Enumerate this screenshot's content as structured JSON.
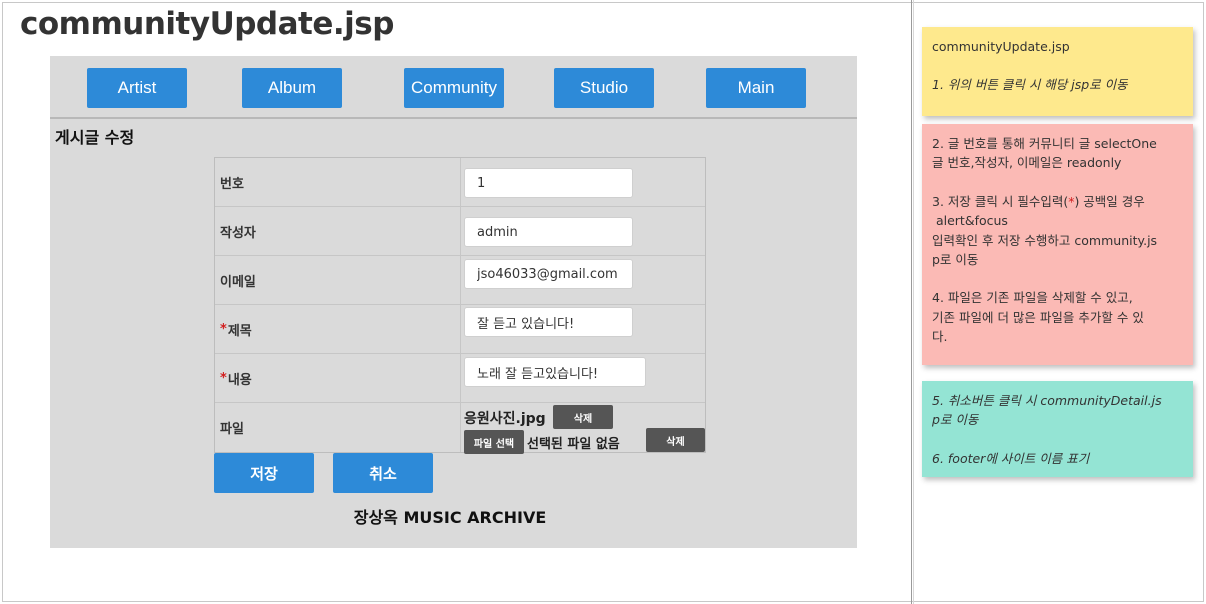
{
  "page": {
    "title": "communityUpdate.jsp"
  },
  "nav": [
    {
      "label": "Artist"
    },
    {
      "label": "Album"
    },
    {
      "label": "Community"
    },
    {
      "label": "Studio"
    },
    {
      "label": "Main"
    }
  ],
  "section_title": "게시글 수정",
  "form": {
    "number": {
      "label": "번호",
      "value": "1"
    },
    "author": {
      "label": "작성자",
      "value": "admin"
    },
    "email": {
      "label": "이메일",
      "value": "jso46033@gmail.com"
    },
    "subject": {
      "required_mark": "*",
      "label": "제목",
      "value": "잘 듣고 있습니다!"
    },
    "content": {
      "required_mark": "*",
      "label": "내용",
      "value": "노래 잘 듣고있습니다!"
    },
    "file": {
      "label": "파일",
      "existing_name": "응원사진.jpg",
      "delete_label": "삭제",
      "choose_label": "파일 선택",
      "status": "선택된 파일 없음",
      "delete_new_label": "삭제"
    }
  },
  "actions": {
    "save": "저장",
    "cancel": "취소"
  },
  "footer": "장상옥 MUSIC ARCHIVE",
  "notes": {
    "yellow": {
      "line1": "communityUpdate.jsp",
      "line2": "1. 위의 버튼 클릭 시 해당 jsp로 이동"
    },
    "red": {
      "l1": "2. 글 번호를 통해 커뮤니티 글 selectOne",
      "l2": "글 번호,작성자, 이메일은 readonly",
      "l3a": "3. 저장 클릭 시 필수입력(",
      "l3star": "*",
      "l3b": ") 공백일 경우",
      "l4": " alert&focus",
      "l5": "입력확인 후 저장 수행하고 community.js",
      "l6": "p로 이동",
      "l7": "4. 파일은 기존 파일을 삭제할 수 있고,",
      "l8": "기존 파일에 더 많은 파일을 추가할 수 있",
      "l9": "다."
    },
    "green": {
      "l1": "5. 취소버튼 클릭 시 communityDetail.js",
      "l2": "p로 이동",
      "l3": "6. footer에 사이트 이름 표기"
    }
  },
  "colors": {
    "nav_button": "#2d8ad8",
    "canvas": "#dadada",
    "required_mark": "#d21e1e",
    "dark_button": "#555555",
    "note_yellow": "#fee98d",
    "note_red": "#fbbab5",
    "note_green": "#94e4d4"
  }
}
